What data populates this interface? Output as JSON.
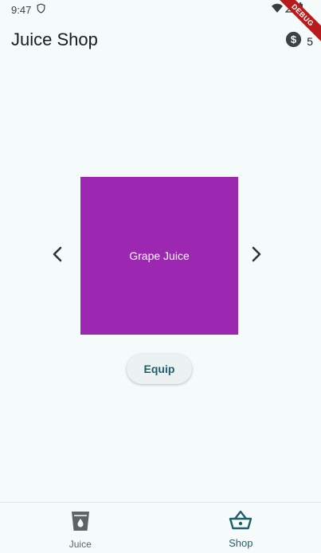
{
  "status_bar": {
    "time": "9:47"
  },
  "debug_banner": {
    "label": "DEBUG"
  },
  "app_bar": {
    "title": "Juice Shop",
    "coin_count": "5"
  },
  "carousel": {
    "current_item": {
      "name": "Grape Juice",
      "color": "#9c27b0"
    }
  },
  "equip_button": {
    "label": "Equip"
  },
  "bottom_nav": {
    "items": [
      {
        "label": "Juice",
        "icon": "cup-icon",
        "active": false
      },
      {
        "label": "Shop",
        "icon": "basket-icon",
        "active": true
      }
    ]
  },
  "colors": {
    "accent": "#1f5f6b",
    "background": "#f5fbfb",
    "card": "#9c27b0"
  }
}
